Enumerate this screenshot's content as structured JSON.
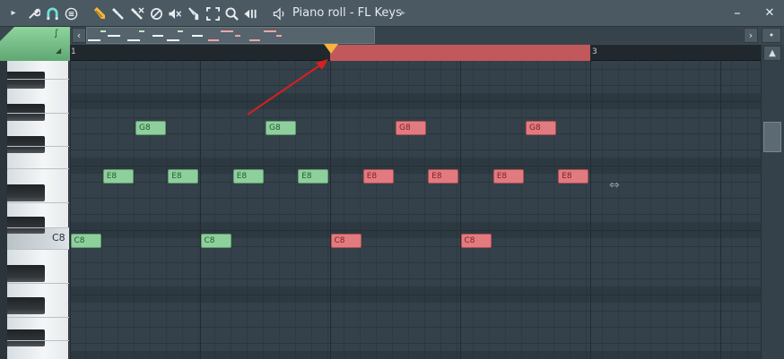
{
  "window": {
    "title": "Piano roll - FL Keys",
    "title_arrow": "▸",
    "minimize": "–",
    "close": "✕"
  },
  "toolbar": {
    "icons": [
      {
        "name": "menu-arrow-icon",
        "glyph": "▸"
      },
      {
        "name": "wrench-icon",
        "glyph": "🔧"
      },
      {
        "name": "magnet-icon",
        "glyph": "∩"
      },
      {
        "name": "options-icon",
        "glyph": "⊜"
      },
      {
        "name": "pencil-icon",
        "glyph": "✎"
      },
      {
        "name": "paint-brush-icon",
        "glyph": "⚒"
      },
      {
        "name": "delete-icon",
        "glyph": "✂"
      },
      {
        "name": "mute-circle-icon",
        "glyph": "⊘"
      },
      {
        "name": "speaker-mute-icon",
        "glyph": "◄"
      },
      {
        "name": "slice-icon",
        "glyph": "⊗"
      },
      {
        "name": "select-icon",
        "glyph": "⛶"
      },
      {
        "name": "zoom-icon",
        "glyph": "🔍"
      },
      {
        "name": "playback-icon",
        "glyph": "◄‖"
      },
      {
        "name": "speaker-icon",
        "glyph": "◁)"
      }
    ]
  },
  "overview": {
    "prev": "‹",
    "next": "›",
    "pin": "•",
    "corner_icon": "∫",
    "corner_arrow": "◢"
  },
  "ruler": {
    "bar1": "1",
    "bar3": "3"
  },
  "keyboard": {
    "c8_label": "C8"
  },
  "scrollbar": {
    "up": "▲"
  },
  "notes": [
    {
      "pitch": "G8",
      "color": "green",
      "start_step": 4,
      "row": "G8"
    },
    {
      "pitch": "G8",
      "color": "green",
      "start_step": 12,
      "row": "G8"
    },
    {
      "pitch": "G8",
      "color": "red",
      "start_step": 20,
      "row": "G8"
    },
    {
      "pitch": "G8",
      "color": "red",
      "start_step": 28,
      "row": "G8"
    },
    {
      "pitch": "E8",
      "color": "green",
      "start_step": 2,
      "row": "E8"
    },
    {
      "pitch": "E8",
      "color": "green",
      "start_step": 6,
      "row": "E8"
    },
    {
      "pitch": "E8",
      "color": "green",
      "start_step": 10,
      "row": "E8"
    },
    {
      "pitch": "E8",
      "color": "green",
      "start_step": 14,
      "row": "E8"
    },
    {
      "pitch": "E8",
      "color": "red",
      "start_step": 18,
      "row": "E8"
    },
    {
      "pitch": "E8",
      "color": "red",
      "start_step": 22,
      "row": "E8"
    },
    {
      "pitch": "E8",
      "color": "red",
      "start_step": 26,
      "row": "E8"
    },
    {
      "pitch": "E8",
      "color": "red",
      "start_step": 30,
      "row": "E8"
    },
    {
      "pitch": "C8",
      "color": "green",
      "start_step": 0,
      "row": "C8"
    },
    {
      "pitch": "C8",
      "color": "green",
      "start_step": 8,
      "row": "C8"
    },
    {
      "pitch": "C8",
      "color": "red",
      "start_step": 16,
      "row": "C8"
    },
    {
      "pitch": "C8",
      "color": "red",
      "start_step": 24,
      "row": "C8"
    }
  ],
  "colors": {
    "green_note": "#8ed09c",
    "red_note": "#e27b7f",
    "selection": "#c0585c",
    "marker": "#f4b53d",
    "arrow": "#d42020"
  }
}
